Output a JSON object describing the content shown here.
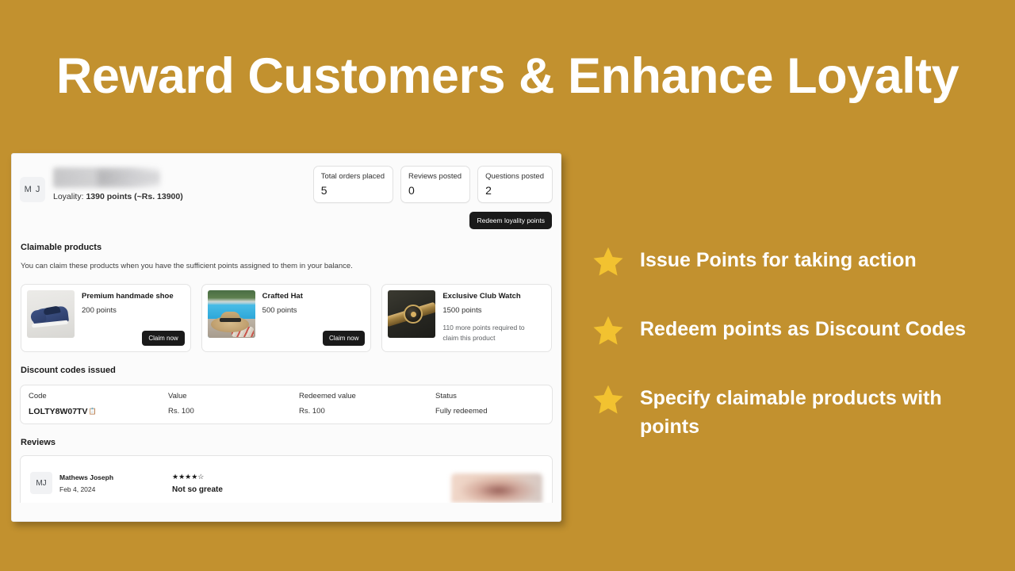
{
  "hero": {
    "title": "Reward Customers & Enhance Loyalty",
    "background_color": "#c2912f",
    "text_color": "#ffffff"
  },
  "app": {
    "customer": {
      "avatar_initials": "M J",
      "name_redacted": true,
      "loyalty_label": "Loyality:",
      "loyalty_value": "1390 points (~Rs. 13900)"
    },
    "stats": [
      {
        "label": "Total orders placed",
        "value": "5"
      },
      {
        "label": "Reviews posted",
        "value": "0"
      },
      {
        "label": "Questions posted",
        "value": "2"
      }
    ],
    "redeem_button": "Redeem loyality points",
    "claimable": {
      "title": "Claimable products",
      "description": "You can claim these products when you have the sufficient points assigned to them in your balance.",
      "products": [
        {
          "name": "Premium handmade shoe",
          "points": "200 points",
          "action": "Claim now",
          "claimable": true,
          "note": ""
        },
        {
          "name": "Crafted Hat",
          "points": "500 points",
          "action": "Claim now",
          "claimable": true,
          "note": ""
        },
        {
          "name": "Exclusive Club Watch",
          "points": "1500 points",
          "action": "",
          "claimable": false,
          "note": "110 more points required to claim this product"
        }
      ]
    },
    "discount_codes": {
      "title": "Discount codes issued",
      "columns": [
        "Code",
        "Value",
        "Redeemed value",
        "Status"
      ],
      "rows": [
        {
          "code": "LOLTY8W07TV",
          "value": "Rs. 100",
          "redeemed_value": "Rs. 100",
          "status": "Fully redeemed"
        }
      ]
    },
    "reviews": {
      "title": "Reviews",
      "items": [
        {
          "avatar_initials": "MJ",
          "author": "Mathews Joseph",
          "date": "Feb 4, 2024",
          "stars": "★★★★☆",
          "rating": 4,
          "max_rating": 5,
          "review_title": "Not so greate"
        }
      ]
    }
  },
  "features": {
    "star_color": "#f2c230",
    "items": [
      {
        "label": "Issue Points for taking action"
      },
      {
        "label": "Redeem points as Discount Codes"
      },
      {
        "label": "Specify claimable products with points"
      }
    ]
  }
}
